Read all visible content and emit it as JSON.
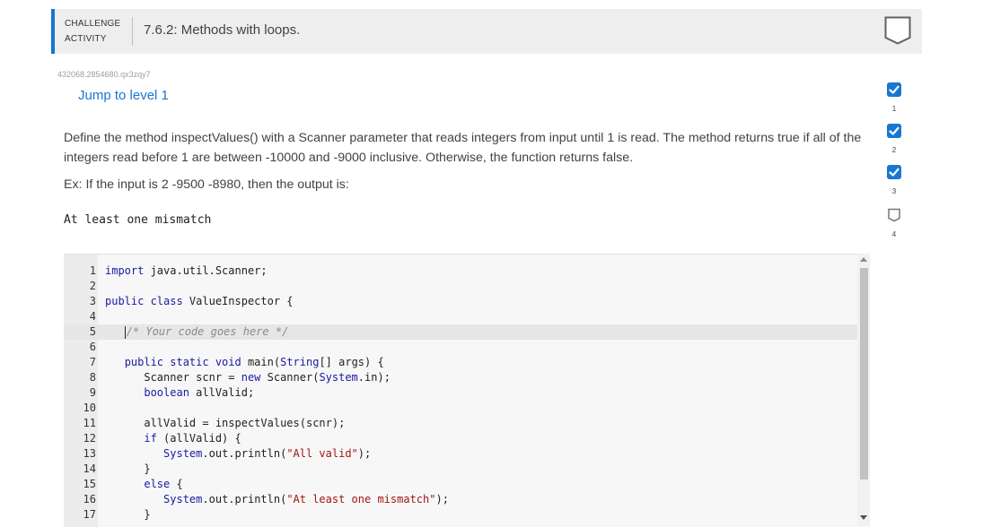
{
  "header": {
    "challenge_label_line1": "CHALLENGE",
    "challenge_label_line2": "ACTIVITY",
    "title": "7.6.2: Methods with loops."
  },
  "serial": "432068.2854680.qx3zqy7",
  "jump_link": "Jump to level 1",
  "description": "Define the method inspectValues() with a Scanner parameter that reads integers from input until 1 is read. The method returns true if all of the integers read before 1 are between -10000 and -9000 inclusive. Otherwise, the function returns false.",
  "example": "Ex: If the input is 2 -9500 -8980, then the output is:",
  "expected_output": "At least one mismatch",
  "editor": {
    "line_numbers": [
      "1",
      "2",
      "3",
      "4",
      "5",
      "6",
      "7",
      "8",
      "9",
      "10",
      "11",
      "12",
      "13",
      "14",
      "15",
      "16",
      "17"
    ]
  },
  "levels": [
    {
      "number": "1",
      "status": "completed"
    },
    {
      "number": "2",
      "status": "completed"
    },
    {
      "number": "3",
      "status": "completed"
    },
    {
      "number": "4",
      "status": "incomplete"
    }
  ],
  "colors": {
    "accent": "#1976d2",
    "header_bg": "#eeeeee",
    "editor_bg": "#f7f7f7"
  }
}
